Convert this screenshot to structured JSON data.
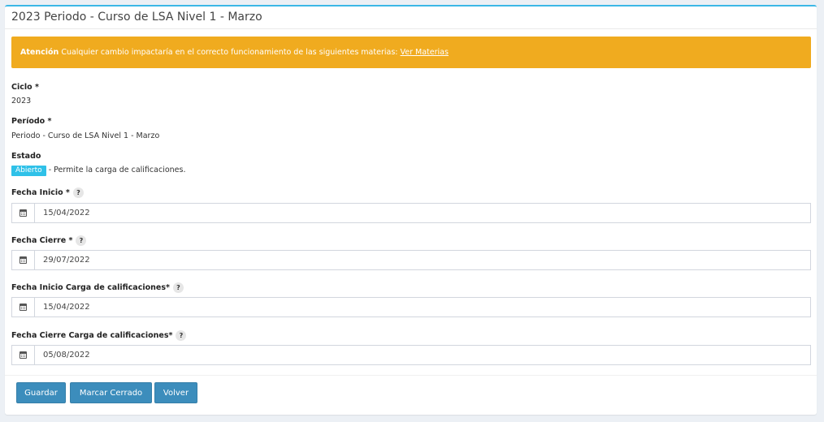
{
  "header": {
    "title": "2023 Periodo - Curso de LSA Nivel 1 - Marzo"
  },
  "alert": {
    "strong": "Atención",
    "message": "Cualquier cambio impactaría en el correcto funcionamiento de las siguientes materias:",
    "link": "Ver Materias",
    "color": "#f0ab1f"
  },
  "form": {
    "ciclo_label": "Ciclo *",
    "ciclo_value": "2023",
    "periodo_label": "Período *",
    "periodo_value": "Periodo - Curso de LSA Nivel 1 - Marzo",
    "estado_label": "Estado",
    "estado_badge": "Abierto",
    "estado_desc": "- Permite la carga de calificaciones.",
    "help_glyph": "?",
    "fecha_inicio": {
      "label": "Fecha Inicio *",
      "value": "15/04/2022",
      "icon": "calendar-icon"
    },
    "fecha_cierre": {
      "label": "Fecha Cierre *",
      "value": "29/07/2022",
      "icon": "calendar-icon"
    },
    "fecha_inicio_carga": {
      "label": "Fecha Inicio Carga de calificaciones*",
      "value": "15/04/2022",
      "icon": "calendar-icon"
    },
    "fecha_cierre_carga": {
      "label": "Fecha Cierre Carga de calificaciones*",
      "value": "05/08/2022",
      "icon": "calendar-icon"
    }
  },
  "actions": {
    "save": "Guardar",
    "mark_closed": "Marcar Cerrado",
    "back": "Volver"
  },
  "colors": {
    "accent": "#3c8dbc",
    "badge": "#2fc1e8",
    "top_border": "#3cb7e6"
  }
}
